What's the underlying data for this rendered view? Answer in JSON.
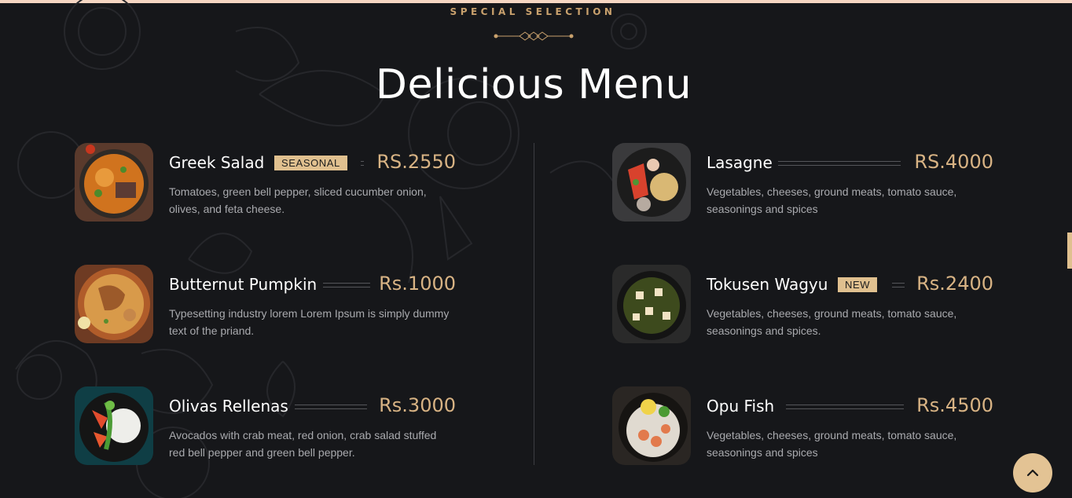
{
  "section": {
    "eyebrow": "SPECIAL SELECTION",
    "title": "Delicious Menu"
  },
  "colors": {
    "background": "#16171a",
    "accent": "#e0c08f",
    "price": "#d8b384",
    "top_strip": "#f5d6c2"
  },
  "menu": {
    "left": [
      {
        "name": "Greek Salad",
        "badge": "SEASONAL",
        "price": "RS.2550",
        "description": "Tomatoes, green bell pepper, sliced cucumber onion, olives, and feta cheese."
      },
      {
        "name": "Butternut Pumpkin",
        "price": "Rs.1000",
        "description": "Typesetting industry lorem Lorem Ipsum is simply dummy text of the priand."
      },
      {
        "name": "Olivas Rellenas",
        "price": "Rs.3000",
        "description": "Avocados with crab meat, red onion, crab salad stuffed red bell pepper and green bell pepper."
      }
    ],
    "right": [
      {
        "name": "Lasagne",
        "price": "RS.4000",
        "description": "Vegetables, cheeses, ground meats, tomato sauce, seasonings and spices"
      },
      {
        "name": "Tokusen Wagyu",
        "badge": "NEW",
        "price": "Rs.2400",
        "description": "Vegetables, cheeses, ground meats, tomato sauce, seasonings and spices."
      },
      {
        "name": "Opu Fish",
        "price": "Rs.4500",
        "description": "Vegetables, cheeses, ground meats, tomato sauce, seasonings and spices"
      }
    ]
  },
  "icons": {
    "scroll_top": "chevron-up-icon",
    "ornament": "diamond-divider-icon"
  }
}
